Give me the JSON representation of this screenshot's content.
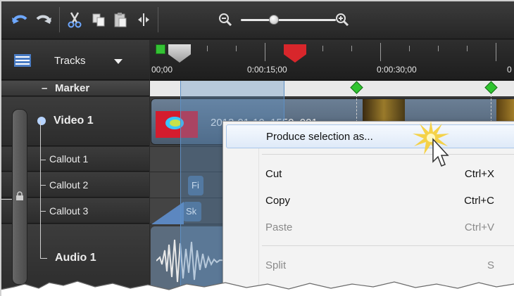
{
  "toolbar": {
    "buttons": [
      "undo-icon",
      "redo-icon",
      "cut-icon",
      "copy-icon",
      "paste-icon",
      "split-icon",
      "zoom-out-icon",
      "zoom-in-icon"
    ],
    "zoom_level_fraction": 0.32
  },
  "tracks_header": {
    "label": "Tracks",
    "icon": "tracks-panel-icon"
  },
  "ruler": {
    "labels": [
      "00;00",
      "0:00:15;00",
      "0:00:30;00",
      "0"
    ]
  },
  "tracks": [
    {
      "label": "Marker"
    },
    {
      "label": "Video 1"
    },
    {
      "label": "Callout 1"
    },
    {
      "label": "Callout 2"
    },
    {
      "label": "Callout 3"
    },
    {
      "label": "Audio 1"
    }
  ],
  "clips": {
    "video_clip_name": "2013-01-10_1550_001",
    "callout2_clip_label": "Fi",
    "callout3_clip_label": "Sk"
  },
  "context_menu": {
    "items": [
      {
        "label": "Produce selection as...",
        "shortcut": "",
        "highlighted": true,
        "disabled": false
      },
      {
        "label": "Cut",
        "shortcut": "Ctrl+X",
        "highlighted": false,
        "disabled": false
      },
      {
        "label": "Copy",
        "shortcut": "Ctrl+C",
        "highlighted": false,
        "disabled": false
      },
      {
        "label": "Paste",
        "shortcut": "Ctrl+V",
        "highlighted": false,
        "disabled": true
      },
      {
        "label": "Split",
        "shortcut": "S",
        "highlighted": false,
        "disabled": true
      }
    ]
  },
  "colors": {
    "accent_selection": "#5d8fc4",
    "marker_diamond": "#2fc42f",
    "playhead_red": "#d8262b",
    "playhead_green": "#34c234",
    "menu_highlight": "#dfeaf8"
  }
}
